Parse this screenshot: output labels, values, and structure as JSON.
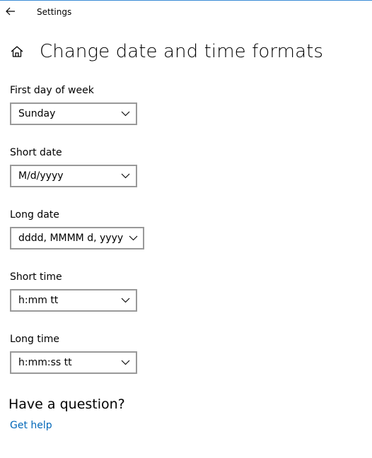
{
  "window": {
    "app_title": "Settings"
  },
  "page": {
    "title": "Change date and time formats"
  },
  "fields": [
    {
      "label": "First day of week",
      "value": "Sunday"
    },
    {
      "label": "Short date",
      "value": "M/d/yyyy"
    },
    {
      "label": "Long date",
      "value": "dddd, MMMM d, yyyy"
    },
    {
      "label": "Short time",
      "value": "h:mm tt"
    },
    {
      "label": "Long time",
      "value": "h:mm:ss tt"
    }
  ],
  "help": {
    "heading": "Have a question?",
    "link_label": "Get help"
  },
  "icons": {
    "back": "back-arrow-icon",
    "home": "home-icon",
    "dropdown": "chevron-down-icon"
  },
  "colors": {
    "accent_link": "#0067b8",
    "dropdown_border": "#999999",
    "window_top_border": "#3c8dd6"
  }
}
